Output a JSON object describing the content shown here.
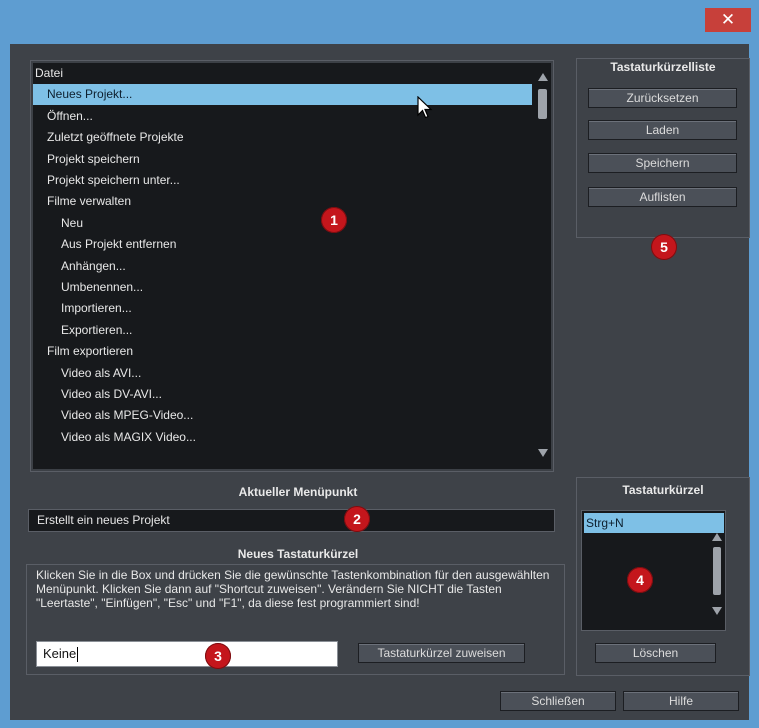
{
  "dialog": {
    "close_glyph": "✕"
  },
  "menu_tree": {
    "items": [
      {
        "label": "Datei",
        "level": 0,
        "selected": false
      },
      {
        "label": "Neues Projekt...",
        "level": 1,
        "selected": true
      },
      {
        "label": "Öffnen...",
        "level": 1,
        "selected": false
      },
      {
        "label": "Zuletzt geöffnete Projekte",
        "level": 1,
        "selected": false
      },
      {
        "label": "Projekt speichern",
        "level": 1,
        "selected": false
      },
      {
        "label": "Projekt speichern unter...",
        "level": 1,
        "selected": false
      },
      {
        "label": "Filme verwalten",
        "level": 1,
        "selected": false
      },
      {
        "label": "Neu",
        "level": 2,
        "selected": false
      },
      {
        "label": "Aus Projekt entfernen",
        "level": 2,
        "selected": false
      },
      {
        "label": "Anhängen...",
        "level": 2,
        "selected": false
      },
      {
        "label": "Umbenennen...",
        "level": 2,
        "selected": false
      },
      {
        "label": "Importieren...",
        "level": 2,
        "selected": false
      },
      {
        "label": "Exportieren...",
        "level": 2,
        "selected": false
      },
      {
        "label": "Film exportieren",
        "level": 1,
        "selected": false
      },
      {
        "label": "Video als AVI...",
        "level": 2,
        "selected": false
      },
      {
        "label": "Video als DV-AVI...",
        "level": 2,
        "selected": false
      },
      {
        "label": "Video als MPEG-Video...",
        "level": 2,
        "selected": false
      },
      {
        "label": "Video als MAGIX Video...",
        "level": 2,
        "selected": false
      }
    ]
  },
  "current_item": {
    "heading": "Aktueller Menüpunkt",
    "value": "Erstellt ein neues Projekt"
  },
  "new_shortcut": {
    "heading": "Neues Tastaturkürzel",
    "instructions": "Klicken Sie in die Box und drücken Sie die gewünschte Tastenkombination für den ausgewählten Menüpunkt. Klicken Sie dann auf \"Shortcut zuweisen\". Verändern Sie NICHT die Tasten \"Leertaste\", \"Einfügen\", \"Esc\" und \"F1\", da diese fest programmiert sind!",
    "input_value": "Keine",
    "assign_label": "Tastaturkürzel zuweisen"
  },
  "shortcut_list": {
    "heading": "Tastaturkürzelliste",
    "buttons": [
      "Zurücksetzen",
      "Laden",
      "Speichern",
      "Auflisten"
    ]
  },
  "shortcuts": {
    "heading": "Tastaturkürzel",
    "items": [
      "Strg+N"
    ],
    "delete_label": "Löschen"
  },
  "footer": {
    "close_label": "Schließen",
    "help_label": "Hilfe"
  },
  "badges": [
    "1",
    "2",
    "3",
    "4",
    "5"
  ],
  "colors": {
    "title_bar": "#5e9dd1",
    "close_button": "#c7403a",
    "panel_bg": "#3e4248",
    "list_bg": "#17191c",
    "selection": "#7ec0e6",
    "badge": "#c4161c"
  }
}
